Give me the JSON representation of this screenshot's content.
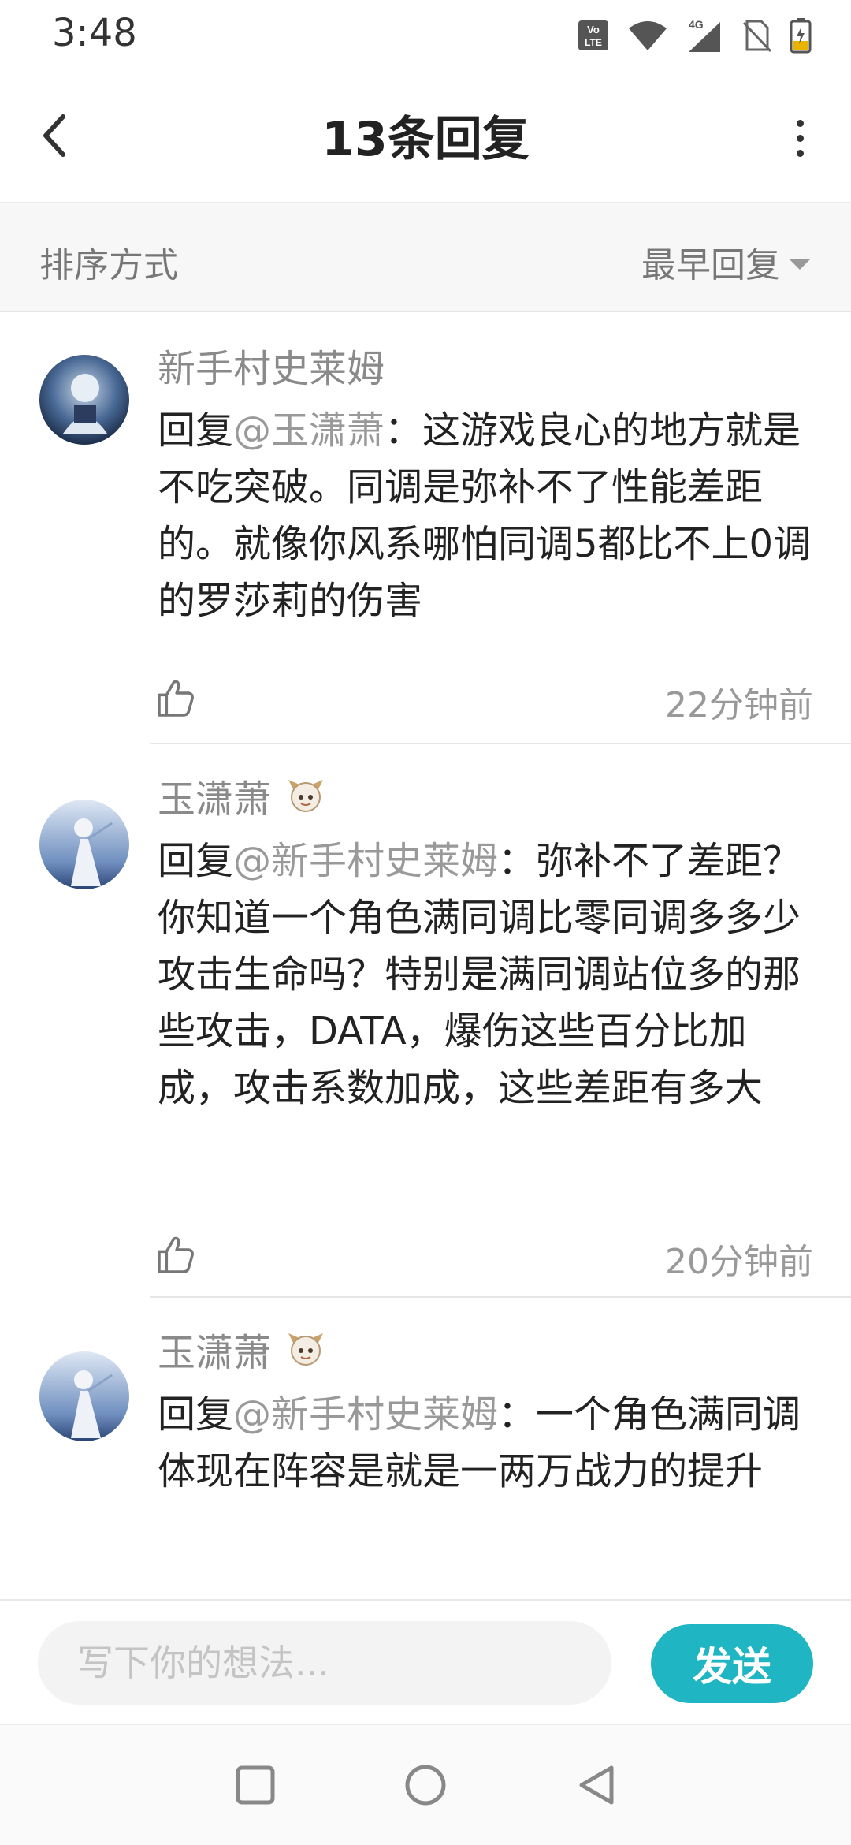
{
  "status_bar": {
    "time": "3:48",
    "icons": [
      "volte-icon",
      "wifi-icon",
      "signal-4g-icon",
      "no-sim-icon",
      "battery-charging-icon"
    ],
    "network_label": "4G"
  },
  "header": {
    "title": "13条回复",
    "back_icon": "chevron-left-icon",
    "more_icon": "more-vertical-icon"
  },
  "sort": {
    "label": "排序方式",
    "value": "最早回复"
  },
  "comments": [
    {
      "author": "新手村史莱姆",
      "reply_prefix": "回复",
      "mention": "@玉潇萧",
      "text": "：这游戏良心的地方就是不吃突破。同调是弥补不了性能差距的。就像你风系哪怕同调5都比不上0调的罗莎莉的伤害",
      "time": "22分钟前"
    },
    {
      "author": "玉潇萧",
      "reply_prefix": "回复",
      "mention": "@新手村史莱姆",
      "text": "：弥补不了差距？你知道一个角色满同调比零同调多多少攻击生命吗？特别是满同调站位多的那些攻击，DATA，爆伤这些百分比加成，攻击系数加成，这些差距有多大",
      "time": "20分钟前"
    },
    {
      "author": "玉潇萧",
      "reply_prefix": "回复",
      "mention": "@新手村史莱姆",
      "text": "：一个角色满同调体现在阵容是就是一两万战力的提升"
    }
  ],
  "input": {
    "placeholder": "写下你的想法...",
    "send_label": "发送"
  },
  "colors": {
    "accent": "#1fb5c3",
    "mention": "#999999",
    "secondary_text": "#8a8a8a"
  }
}
